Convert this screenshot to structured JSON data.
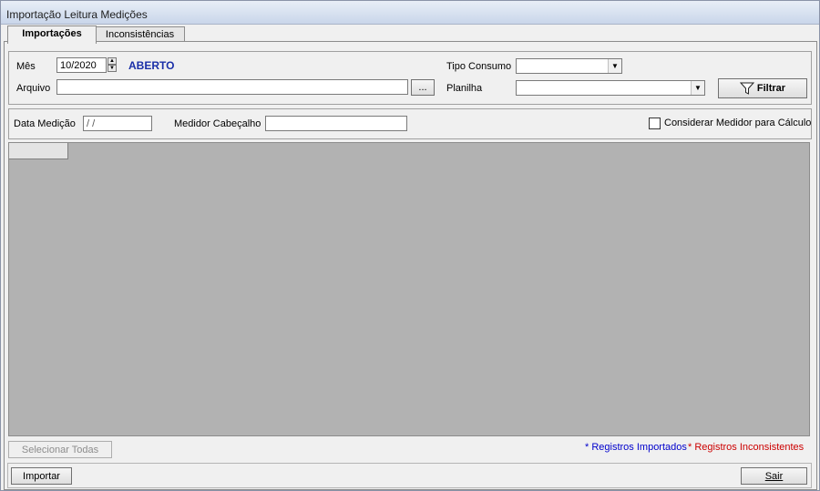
{
  "window": {
    "title": "Importação Leitura Medições"
  },
  "tabs": [
    {
      "label": "Importações",
      "active": true
    },
    {
      "label": "Inconsistências",
      "active": false
    }
  ],
  "filters": {
    "mes_label": "Mês",
    "mes_value": "10/2020",
    "status": "ABERTO",
    "arquivo_label": "Arquivo",
    "arquivo_value": "",
    "browse_label": "...",
    "tipo_consumo_label": "Tipo Consumo",
    "tipo_consumo_value": "",
    "planilha_label": "Planilha",
    "planilha_value": "",
    "filtrar_label": "Filtrar"
  },
  "measure": {
    "data_medicao_label": "Data Medição",
    "data_medicao_value": " /  /",
    "medidor_cabecalho_label": "Medidor Cabeçalho",
    "medidor_cabecalho_value": "",
    "considerar_label": "Considerar Medidor para Cálculo",
    "considerar_checked": false
  },
  "footer": {
    "selecionar_todas_label": "Selecionar Todas",
    "legend_imported": "* Registros Importados",
    "legend_inconsistent": "* Registros Inconsistentes",
    "importar_label": "Importar",
    "sair_label": "Sair"
  },
  "colors": {
    "status": "#1a2fa8",
    "imported": "#0000cc",
    "inconsistent": "#cc0000",
    "grid_bg": "#b2b2b2"
  }
}
